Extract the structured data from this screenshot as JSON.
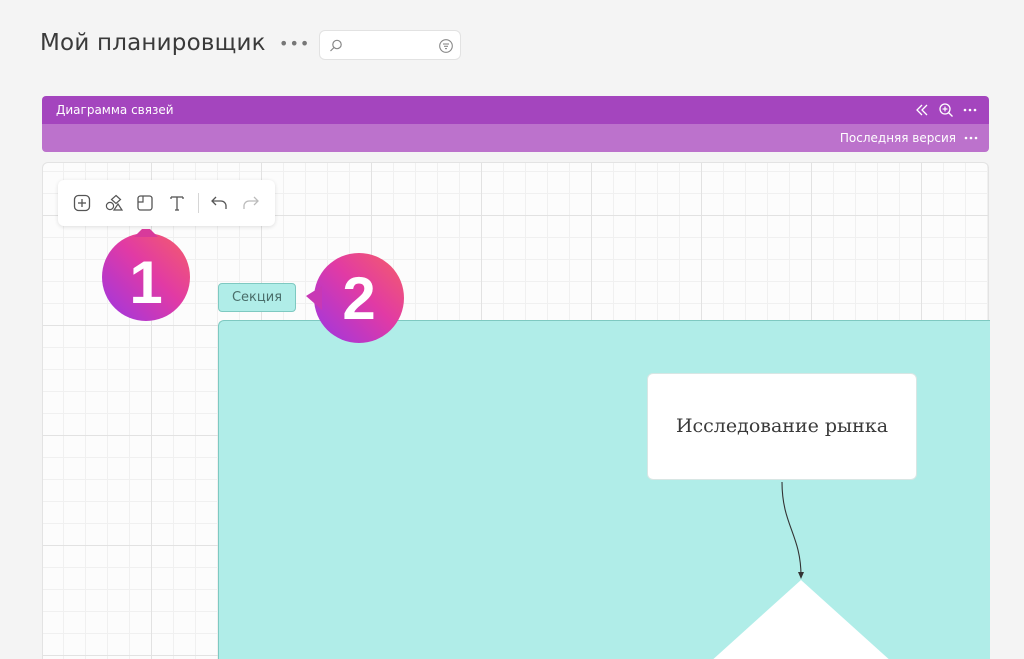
{
  "header": {
    "title": "Мой планировщик",
    "more_icon": "more-horizontal-icon",
    "search": {
      "placeholder": "",
      "value": "",
      "icon": "search-icon",
      "filter_icon": "filter-icon"
    }
  },
  "panel": {
    "title": "Диаграмма связей",
    "header_icons": [
      "collapse-icon",
      "zoom-in-icon",
      "more-horizontal-icon"
    ],
    "version_label": "Последняя версия",
    "colors": {
      "header": "#a445be",
      "subheader": "#bc72cc"
    }
  },
  "toolbar": {
    "tools": [
      "add-icon",
      "shapes-icon",
      "section-icon",
      "text-icon",
      "undo-icon",
      "redo-icon"
    ]
  },
  "canvas": {
    "section_label": "Секция",
    "section_color": "#b0ede8",
    "node_text": "Исследование рынка"
  },
  "callouts": {
    "one": "1",
    "two": "2"
  }
}
